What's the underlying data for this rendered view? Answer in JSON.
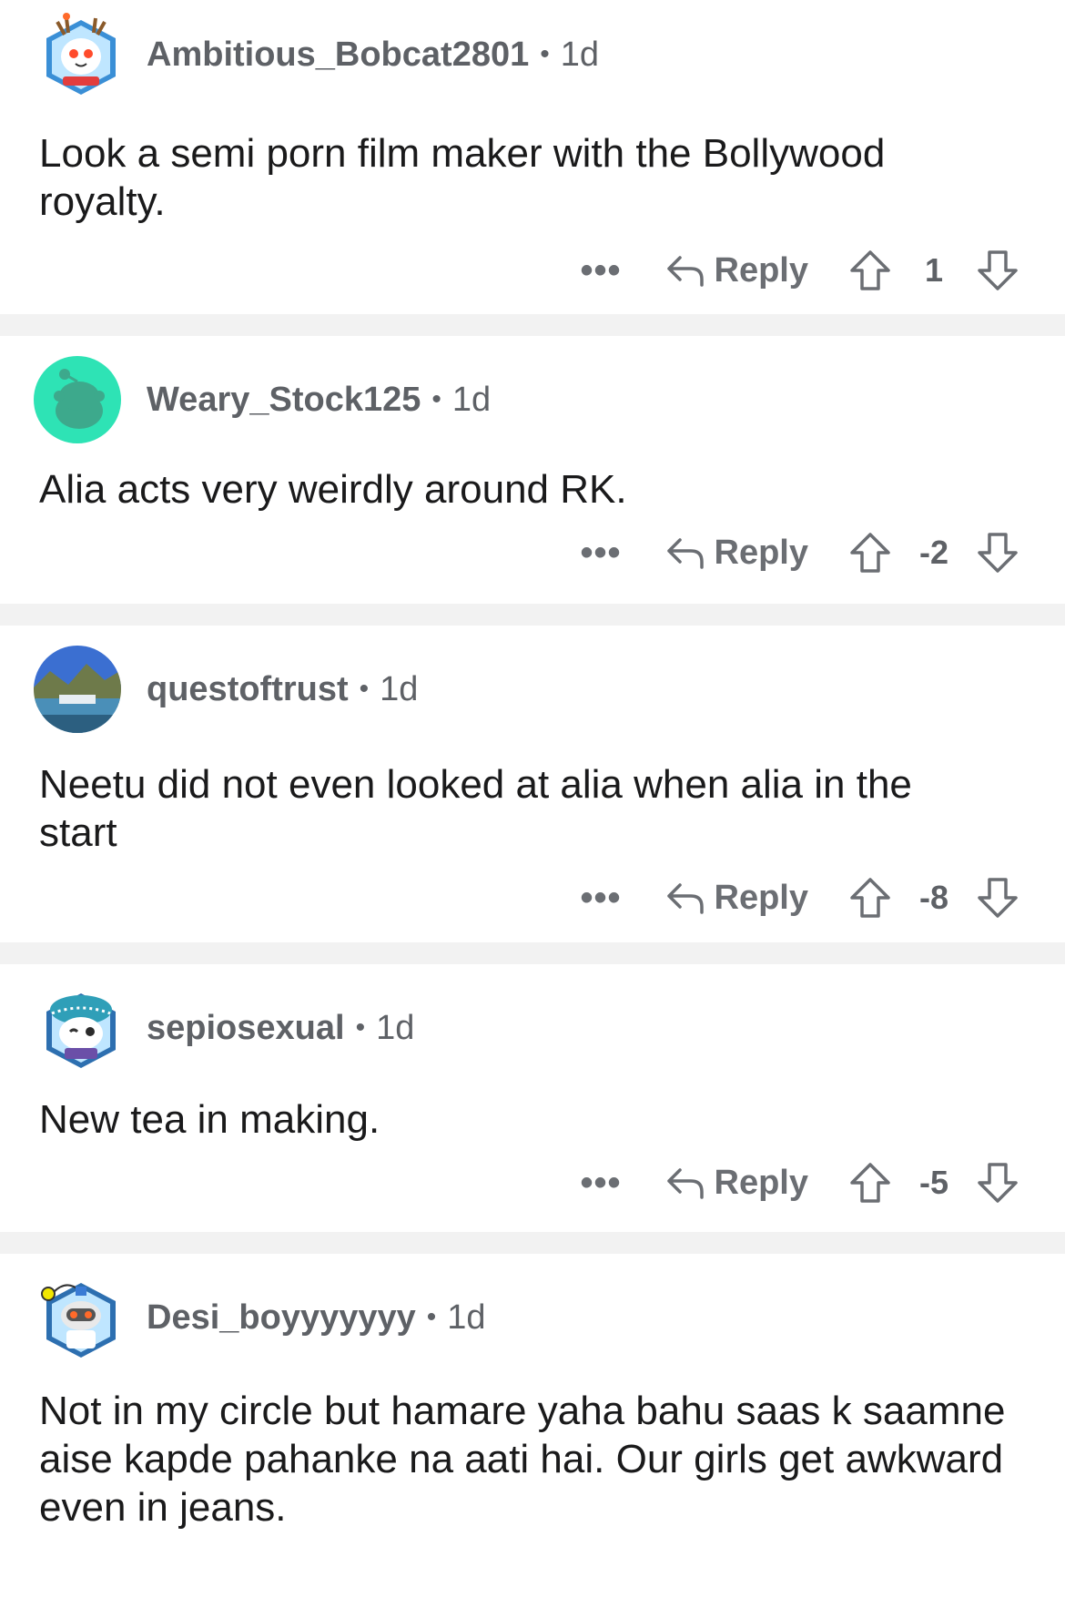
{
  "comments": [
    {
      "username": "Ambitious_Bobcat2801",
      "age": "1d",
      "text": "Look a semi porn film maker with the Bollywood royalty.",
      "reply_label": "Reply",
      "score": "1",
      "avatar": "snoo-reindeer-avatar"
    },
    {
      "username": "Weary_Stock125",
      "age": "1d",
      "text": "Alia acts very weirdly around RK.",
      "reply_label": "Reply",
      "score": "-2",
      "avatar": "snoo-default-teal-avatar"
    },
    {
      "username": "questoftrust",
      "age": "1d",
      "text": "Neetu did not even looked at alia when alia in the start",
      "reply_label": "Reply",
      "score": "-8",
      "avatar": "landscape-photo-avatar"
    },
    {
      "username": "sepiosexual",
      "age": "1d",
      "text": "New tea in making.",
      "reply_label": "Reply",
      "score": "-5",
      "avatar": "snoo-turban-avatar"
    },
    {
      "username": "Desi_boyyyyyyy",
      "age": "1d",
      "text": "Not in my circle but hamare yaha bahu saas k saamne aise kapde pahanke na aati hai. Our girls get awkward even in jeans.",
      "avatar": "snoo-robot-avatar"
    }
  ],
  "icons": {
    "more": "more-options-icon",
    "reply": "reply-arrow-icon",
    "upvote": "upvote-arrow-icon",
    "downvote": "downvote-arrow-icon"
  },
  "colors": {
    "text": "#1a1a1b",
    "meta": "#5e6166",
    "separator": "#f2f2f2",
    "teal_avatar": "#2ee3b5"
  }
}
